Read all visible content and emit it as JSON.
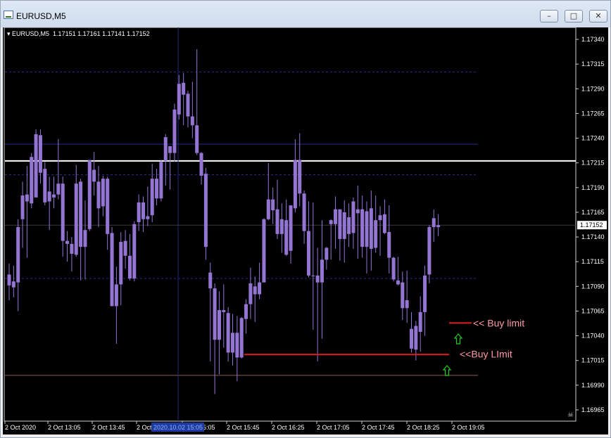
{
  "window": {
    "title": "EURUSD,M5",
    "buttons": [
      "minimize",
      "restore",
      "close"
    ]
  },
  "symbol_info": "EURUSD,M5  1.17151 1.17161 1.17141 1.17152",
  "crosshair_time_label": "2020.10.02 15:05",
  "annotations": {
    "buy_limit_1": "<< Buy limit",
    "buy_limit_2": "<<Buy LImit"
  },
  "colors": {
    "background": "#000000",
    "candle": "#9575d4",
    "hline_white": "#ffffff",
    "hline_blue": "#202a8c",
    "hline_dashed": "#2a2a8a",
    "hline_brown": "#8b5a4a",
    "limit_line": "#e02020",
    "arrow": "#22cc22",
    "axis_text": "#ffffff",
    "label_text": "#ff9aa6"
  },
  "chart_data": {
    "type": "candlestick",
    "title": "EURUSD,M5",
    "ohlc_header": {
      "open": 1.17151,
      "high": 1.17161,
      "low": 1.17141,
      "close": 1.17152
    },
    "current_price": "1.17152",
    "ylim": [
      1.1696,
      1.1735
    ],
    "y_ticks": [
      "1.17340",
      "1.17315",
      "1.17290",
      "1.17265",
      "1.17240",
      "1.17215",
      "1.17190",
      "1.17165",
      "1.17140",
      "1.17115",
      "1.17090",
      "1.17065",
      "1.17040",
      "1.17015",
      "1.16990",
      "1.16965"
    ],
    "x_ticks": [
      "2 Oct 2020",
      "2 Oct 13:05",
      "2 Oct 13:45",
      "2 Oct 14:25",
      "2 Oct 15:05",
      "2 Oct 15:45",
      "2 Oct 16:25",
      "2 Oct 17:05",
      "2 Oct 17:45",
      "2 Oct 18:25",
      "2 Oct 19:05"
    ],
    "horizontal_lines": [
      {
        "price": 1.17307,
        "style": "dashed",
        "color": "#2a2a8a"
      },
      {
        "price": 1.17234,
        "style": "solid",
        "color": "#202a8c"
      },
      {
        "price": 1.17217,
        "style": "solid",
        "color": "#ffffff"
      },
      {
        "price": 1.17203,
        "style": "dashed",
        "color": "#2a2a8a"
      },
      {
        "price": 1.17098,
        "style": "dashed",
        "color": "#2a2a8a"
      },
      {
        "price": 1.17,
        "style": "solid",
        "color": "#8b5a4a"
      }
    ],
    "buy_limits": [
      {
        "price": 1.17053,
        "label": "<< Buy limit"
      },
      {
        "price": 1.17021,
        "label": "<<Buy LImit"
      }
    ],
    "candles": [
      {
        "o": 1.17091,
        "h": 1.17113,
        "l": 1.17076,
        "c": 1.17102
      },
      {
        "o": 1.17089,
        "h": 1.17111,
        "l": 1.17079,
        "c": 1.17095
      },
      {
        "o": 1.17094,
        "h": 1.17158,
        "l": 1.17065,
        "c": 1.1715
      },
      {
        "o": 1.17158,
        "h": 1.17196,
        "l": 1.17129,
        "c": 1.17182
      },
      {
        "o": 1.17183,
        "h": 1.17212,
        "l": 1.17119,
        "c": 1.17176
      },
      {
        "o": 1.17174,
        "h": 1.17225,
        "l": 1.17169,
        "c": 1.17221
      },
      {
        "o": 1.1718,
        "h": 1.17249,
        "l": 1.17182,
        "c": 1.17244
      },
      {
        "o": 1.17243,
        "h": 1.17249,
        "l": 1.17194,
        "c": 1.17205
      },
      {
        "o": 1.17209,
        "h": 1.17216,
        "l": 1.17172,
        "c": 1.17175
      },
      {
        "o": 1.17186,
        "h": 1.17201,
        "l": 1.17147,
        "c": 1.17176
      },
      {
        "o": 1.1718,
        "h": 1.17201,
        "l": 1.17169,
        "c": 1.17183
      },
      {
        "o": 1.17183,
        "h": 1.17239,
        "l": 1.17178,
        "c": 1.17194
      },
      {
        "o": 1.17194,
        "h": 1.17201,
        "l": 1.1712,
        "c": 1.17136
      },
      {
        "o": 1.17136,
        "h": 1.17146,
        "l": 1.17115,
        "c": 1.17133
      },
      {
        "o": 1.17133,
        "h": 1.1714,
        "l": 1.17105,
        "c": 1.17123
      },
      {
        "o": 1.17122,
        "h": 1.17213,
        "l": 1.1712,
        "c": 1.17194
      },
      {
        "o": 1.17196,
        "h": 1.17199,
        "l": 1.17096,
        "c": 1.1713
      },
      {
        "o": 1.1713,
        "h": 1.17177,
        "l": 1.17097,
        "c": 1.17147
      },
      {
        "o": 1.17148,
        "h": 1.17218,
        "l": 1.17146,
        "c": 1.17218
      },
      {
        "o": 1.17208,
        "h": 1.17226,
        "l": 1.17182,
        "c": 1.17196
      },
      {
        "o": 1.17196,
        "h": 1.17212,
        "l": 1.1715,
        "c": 1.17169
      },
      {
        "o": 1.17171,
        "h": 1.17202,
        "l": 1.17161,
        "c": 1.17199
      },
      {
        "o": 1.17199,
        "h": 1.17201,
        "l": 1.17127,
        "c": 1.17143
      },
      {
        "o": 1.17144,
        "h": 1.1715,
        "l": 1.1707,
        "c": 1.1707
      },
      {
        "o": 1.1707,
        "h": 1.1711,
        "l": 1.17032,
        "c": 1.17092
      },
      {
        "o": 1.17092,
        "h": 1.17145,
        "l": 1.17071,
        "c": 1.17135
      },
      {
        "o": 1.17136,
        "h": 1.17147,
        "l": 1.17108,
        "c": 1.17121
      },
      {
        "o": 1.17121,
        "h": 1.17143,
        "l": 1.17096,
        "c": 1.17098
      },
      {
        "o": 1.17098,
        "h": 1.17156,
        "l": 1.17095,
        "c": 1.17153
      },
      {
        "o": 1.17155,
        "h": 1.17183,
        "l": 1.17146,
        "c": 1.17175
      },
      {
        "o": 1.17175,
        "h": 1.17181,
        "l": 1.17145,
        "c": 1.17158
      },
      {
        "o": 1.17158,
        "h": 1.17191,
        "l": 1.17151,
        "c": 1.17161
      },
      {
        "o": 1.17162,
        "h": 1.17214,
        "l": 1.17155,
        "c": 1.17199
      },
      {
        "o": 1.17199,
        "h": 1.17209,
        "l": 1.17172,
        "c": 1.17179
      },
      {
        "o": 1.17179,
        "h": 1.17218,
        "l": 1.17176,
        "c": 1.17216
      },
      {
        "o": 1.17217,
        "h": 1.17244,
        "l": 1.17192,
        "c": 1.17241
      },
      {
        "o": 1.17232,
        "h": 1.17231,
        "l": 1.17188,
        "c": 1.17225
      },
      {
        "o": 1.17225,
        "h": 1.17275,
        "l": 1.17216,
        "c": 1.17269
      },
      {
        "o": 1.17264,
        "h": 1.17304,
        "l": 1.17259,
        "c": 1.17295
      },
      {
        "o": 1.17296,
        "h": 1.17306,
        "l": 1.17253,
        "c": 1.17284
      },
      {
        "o": 1.17285,
        "h": 1.17288,
        "l": 1.17251,
        "c": 1.17262
      },
      {
        "o": 1.17262,
        "h": 1.17297,
        "l": 1.1724,
        "c": 1.17253
      },
      {
        "o": 1.17253,
        "h": 1.1733,
        "l": 1.17223,
        "c": 1.17225
      },
      {
        "o": 1.17225,
        "h": 1.17226,
        "l": 1.17193,
        "c": 1.17202
      },
      {
        "o": 1.17204,
        "h": 1.1721,
        "l": 1.17117,
        "c": 1.1713
      },
      {
        "o": 1.17104,
        "h": 1.17114,
        "l": 1.17014,
        "c": 1.17088
      },
      {
        "o": 1.17088,
        "h": 1.17093,
        "l": 1.16981,
        "c": 1.17036
      },
      {
        "o": 1.17036,
        "h": 1.17085,
        "l": 1.17001,
        "c": 1.17066
      },
      {
        "o": 1.17066,
        "h": 1.17092,
        "l": 1.17028,
        "c": 1.17064
      },
      {
        "o": 1.17063,
        "h": 1.17069,
        "l": 1.17014,
        "c": 1.17023
      },
      {
        "o": 1.17023,
        "h": 1.17062,
        "l": 1.1701,
        "c": 1.17043
      },
      {
        "o": 1.17043,
        "h": 1.1706,
        "l": 1.16994,
        "c": 1.17018
      },
      {
        "o": 1.17018,
        "h": 1.17059,
        "l": 1.17017,
        "c": 1.17058
      },
      {
        "o": 1.17057,
        "h": 1.17077,
        "l": 1.17042,
        "c": 1.17072
      },
      {
        "o": 1.17072,
        "h": 1.17109,
        "l": 1.17057,
        "c": 1.17093
      },
      {
        "o": 1.1709,
        "h": 1.171,
        "l": 1.17054,
        "c": 1.17082
      },
      {
        "o": 1.17082,
        "h": 1.17114,
        "l": 1.17077,
        "c": 1.17094
      },
      {
        "o": 1.17094,
        "h": 1.17159,
        "l": 1.17094,
        "c": 1.17158
      },
      {
        "o": 1.17158,
        "h": 1.17215,
        "l": 1.17157,
        "c": 1.17178
      },
      {
        "o": 1.17178,
        "h": 1.1719,
        "l": 1.17153,
        "c": 1.17167
      },
      {
        "o": 1.17168,
        "h": 1.17198,
        "l": 1.17138,
        "c": 1.17143
      },
      {
        "o": 1.17143,
        "h": 1.17174,
        "l": 1.17124,
        "c": 1.17158
      },
      {
        "o": 1.17157,
        "h": 1.17178,
        "l": 1.17121,
        "c": 1.17122
      },
      {
        "o": 1.17126,
        "h": 1.17172,
        "l": 1.17113,
        "c": 1.17172
      },
      {
        "o": 1.17169,
        "h": 1.17239,
        "l": 1.17165,
        "c": 1.17218
      },
      {
        "o": 1.17218,
        "h": 1.17245,
        "l": 1.17171,
        "c": 1.17184
      },
      {
        "o": 1.17184,
        "h": 1.17187,
        "l": 1.17133,
        "c": 1.17146
      },
      {
        "o": 1.17146,
        "h": 1.17176,
        "l": 1.17099,
        "c": 1.17101
      },
      {
        "o": 1.17101,
        "h": 1.17175,
        "l": 1.17046,
        "c": 1.17101
      },
      {
        "o": 1.17101,
        "h": 1.17129,
        "l": 1.17014,
        "c": 1.17094
      },
      {
        "o": 1.17094,
        "h": 1.17157,
        "l": 1.17037,
        "c": 1.17117
      },
      {
        "o": 1.17117,
        "h": 1.1713,
        "l": 1.17107,
        "c": 1.17129
      },
      {
        "o": 1.17157,
        "h": 1.17158,
        "l": 1.17117,
        "c": 1.17153
      },
      {
        "o": 1.17153,
        "h": 1.17181,
        "l": 1.17128,
        "c": 1.17168
      },
      {
        "o": 1.17168,
        "h": 1.17168,
        "l": 1.17116,
        "c": 1.17138
      },
      {
        "o": 1.17138,
        "h": 1.17177,
        "l": 1.17114,
        "c": 1.17165
      },
      {
        "o": 1.1716,
        "h": 1.17174,
        "l": 1.1713,
        "c": 1.17143
      },
      {
        "o": 1.17144,
        "h": 1.1718,
        "l": 1.17128,
        "c": 1.17176
      },
      {
        "o": 1.17164,
        "h": 1.17192,
        "l": 1.17118,
        "c": 1.17168
      },
      {
        "o": 1.17168,
        "h": 1.17182,
        "l": 1.17119,
        "c": 1.1713
      },
      {
        "o": 1.1713,
        "h": 1.17176,
        "l": 1.17103,
        "c": 1.17166
      },
      {
        "o": 1.17169,
        "h": 1.17187,
        "l": 1.17106,
        "c": 1.17128
      },
      {
        "o": 1.17129,
        "h": 1.17182,
        "l": 1.17124,
        "c": 1.17157
      },
      {
        "o": 1.17157,
        "h": 1.17171,
        "l": 1.17121,
        "c": 1.17162
      },
      {
        "o": 1.17163,
        "h": 1.17178,
        "l": 1.17143,
        "c": 1.17144
      },
      {
        "o": 1.17145,
        "h": 1.17172,
        "l": 1.17103,
        "c": 1.17119
      },
      {
        "o": 1.17119,
        "h": 1.1712,
        "l": 1.17095,
        "c": 1.17097
      },
      {
        "o": 1.17096,
        "h": 1.1712,
        "l": 1.17091,
        "c": 1.17092
      },
      {
        "o": 1.17094,
        "h": 1.17105,
        "l": 1.17056,
        "c": 1.17068
      },
      {
        "o": 1.17068,
        "h": 1.17106,
        "l": 1.17053,
        "c": 1.17076
      },
      {
        "o": 1.17047,
        "h": 1.17064,
        "l": 1.17023,
        "c": 1.17027
      },
      {
        "o": 1.17026,
        "h": 1.17055,
        "l": 1.17015,
        "c": 1.1705
      },
      {
        "o": 1.17044,
        "h": 1.1708,
        "l": 1.17024,
        "c": 1.17064
      },
      {
        "o": 1.17064,
        "h": 1.17111,
        "l": 1.1704,
        "c": 1.17101
      },
      {
        "o": 1.17102,
        "h": 1.17152,
        "l": 1.17093,
        "c": 1.1715
      },
      {
        "o": 1.1715,
        "h": 1.17168,
        "l": 1.17135,
        "c": 1.17159
      },
      {
        "o": 1.1715,
        "h": 1.17163,
        "l": 1.17141,
        "c": 1.17152
      }
    ]
  }
}
